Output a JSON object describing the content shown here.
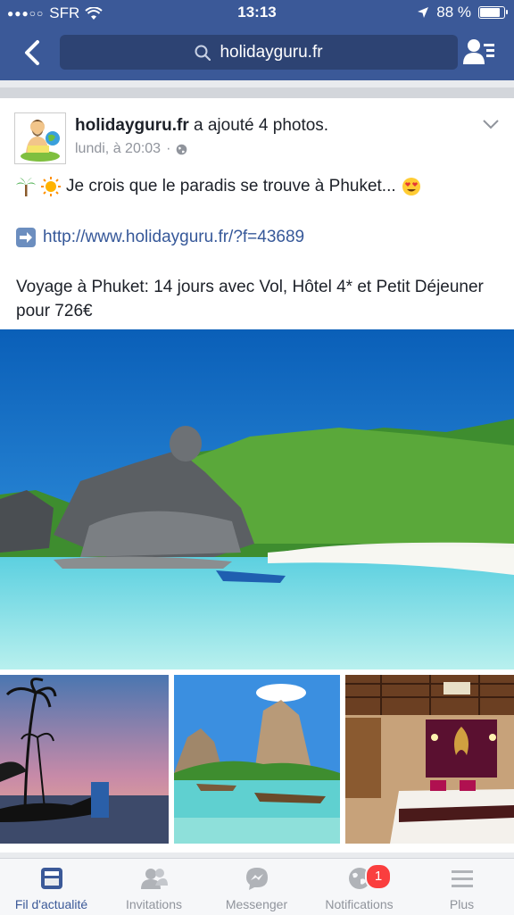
{
  "status_bar": {
    "signal": "●●●○○",
    "carrier": "SFR",
    "time": "13:13",
    "battery": "88 %"
  },
  "nav": {
    "search_text": "holidayguru.fr"
  },
  "post": {
    "author": "holidayguru.fr",
    "action": "a ajouté 4 photos.",
    "timestamp": "lundi, à 20:03",
    "separator": "·",
    "line1": "Je crois que le paradis se trouve à Phuket...",
    "link": "http://www.holidayguru.fr/?f=43689",
    "description": "Voyage à Phuket: 14 jours avec Vol, Hôtel 4* et Petit Déjeuner pour 726€"
  },
  "tabs": [
    {
      "label": "Fil d'actualité",
      "icon": "news-feed-icon"
    },
    {
      "label": "Invitations",
      "icon": "friends-icon"
    },
    {
      "label": "Messenger",
      "icon": "messenger-icon"
    },
    {
      "label": "Notifications",
      "icon": "globe-icon"
    },
    {
      "label": "Plus",
      "icon": "menu-icon"
    }
  ],
  "notifications_badge": "1",
  "colors": {
    "brand": "#3b5998",
    "link": "#365899",
    "badge": "#fa3e3e"
  }
}
